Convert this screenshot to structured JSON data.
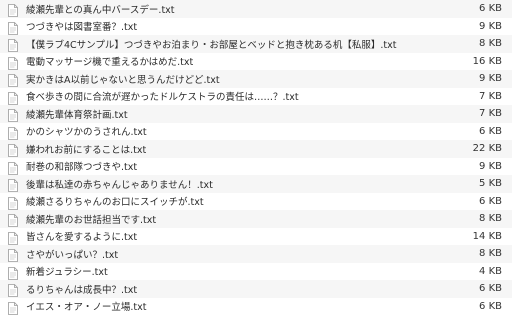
{
  "file_icon": "text-file-icon",
  "files": [
    {
      "name": "綾瀬先輩との真ん中バースデー.txt",
      "size": "6 KB"
    },
    {
      "name": "つづきやは図書室番？.txt",
      "size": "9 KB"
    },
    {
      "name": "【僕ラブ4Cサンプル】つづきやお泊まり・お部屋とベッドと抱き枕ある机【私服】.txt",
      "size": "8 KB"
    },
    {
      "name": "電動マッサージ機で重えるかはめだ.txt",
      "size": "16 KB"
    },
    {
      "name": "実かきはA以前じゃないと思うんだけどど.txt",
      "size": "9 KB"
    },
    {
      "name": "食べ歩きの間に合流が遅かったドルケストラの責任は……？.txt",
      "size": "7 KB"
    },
    {
      "name": "綾瀬先輩体育祭計画.txt",
      "size": "7 KB"
    },
    {
      "name": "かのシャツかのうされん.txt",
      "size": "6 KB"
    },
    {
      "name": "嫌われお前にすることは.txt",
      "size": "22 KB"
    },
    {
      "name": "耐巻の和部隊つづきや.txt",
      "size": "9 KB"
    },
    {
      "name": "後輩は私達の赤ちゃんじゃありません！.txt",
      "size": "5 KB"
    },
    {
      "name": "綾瀬さるりちゃんのお口にスイッチが.txt",
      "size": "6 KB"
    },
    {
      "name": "綾瀬先輩のお世話担当です.txt",
      "size": "8 KB"
    },
    {
      "name": "皆さんを愛するように.txt",
      "size": "14 KB"
    },
    {
      "name": "さやがいっぱい？.txt",
      "size": "8 KB"
    },
    {
      "name": "新着ジュラシー.txt",
      "size": "4 KB"
    },
    {
      "name": "るりちゃんは成長中？.txt",
      "size": "6 KB"
    },
    {
      "name": "イエス・オア・ノー立場.txt",
      "size": "6 KB"
    }
  ]
}
